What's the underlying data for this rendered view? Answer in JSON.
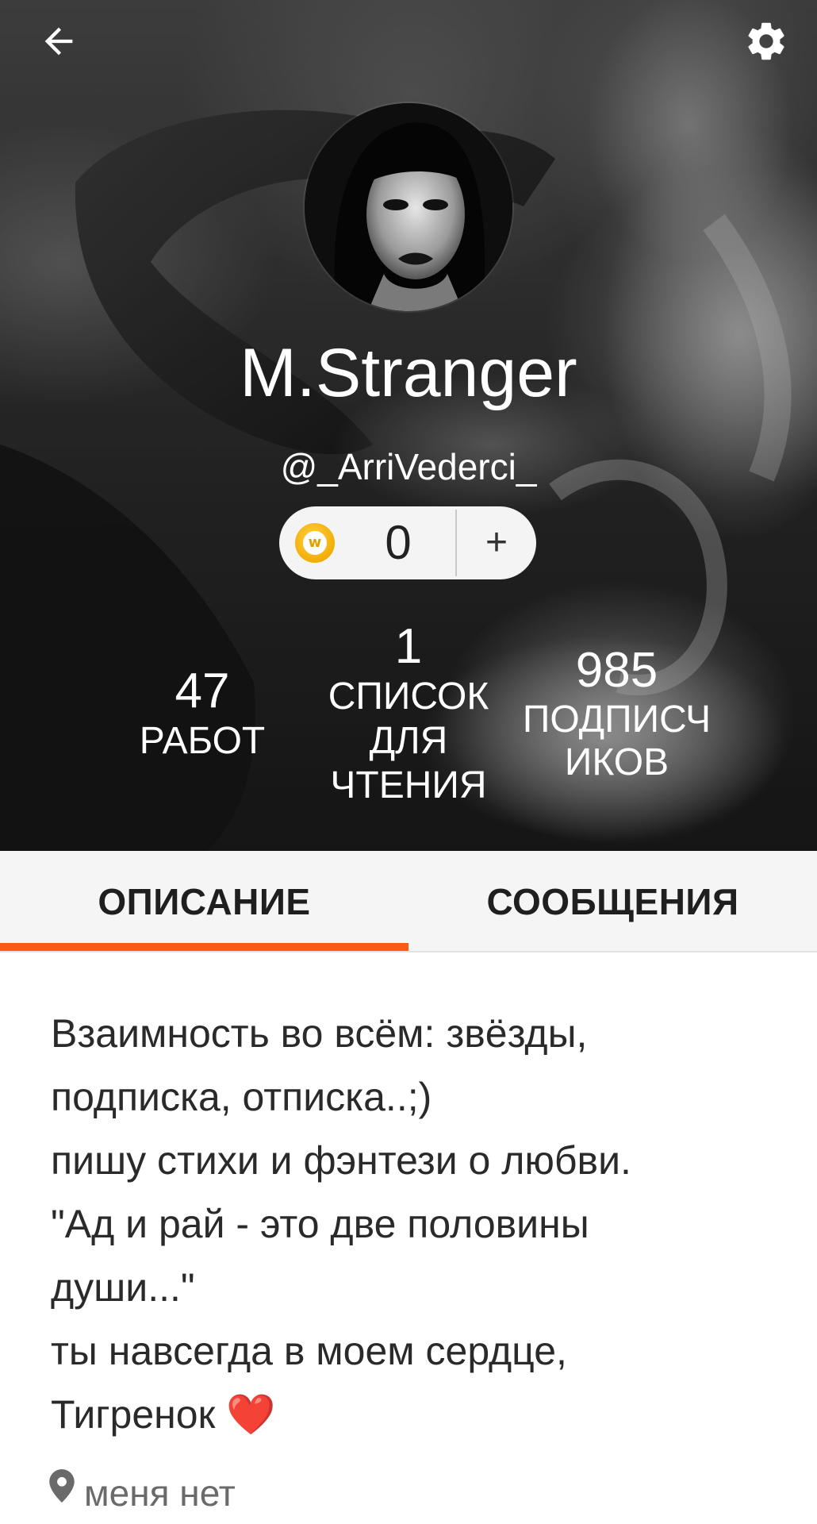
{
  "profile": {
    "display_name": "M.Stranger",
    "username": "@_ArriVederci_",
    "coins": "0",
    "coin_add": "+"
  },
  "stats": {
    "works": {
      "value": "47",
      "label": "РАБОТ"
    },
    "reading_lists": {
      "value": "1",
      "label": "СПИСОК\nДЛЯ\nЧТЕНИЯ"
    },
    "followers": {
      "value": "985",
      "label": "ПОДПИСЧ\nИКОВ"
    }
  },
  "tabs": [
    {
      "label": "ОПИСАНИЕ",
      "active": true
    },
    {
      "label": "СООБЩЕНИЯ",
      "active": false
    }
  ],
  "bio": "Взаимность во всём: звёзды,\nподписка, отписка..;)\nпишу стихи и фэнтези о любви.\n\"Ад и рай - это две половины\nдуши...\"\nты навсегда в моем сердце,\nТигренок ❤️",
  "location": "меня нет",
  "icons": {
    "back": "arrow-left-icon",
    "settings": "gear-icon",
    "coin": "coin-icon",
    "location": "map-pin-icon"
  },
  "colors": {
    "accent": "#ff5a14",
    "tab_bar": "#f5f5f5",
    "text_dark": "#2a2a2a",
    "text_muted": "#6a6a6a"
  }
}
